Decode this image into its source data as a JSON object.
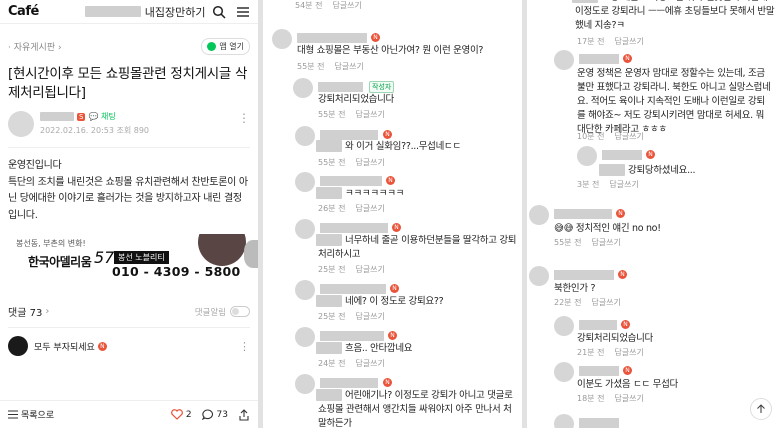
{
  "panel1": {
    "logo": "Café",
    "cafe_name": "내집장만하기",
    "board_link": "· 자유게시판 ›",
    "app_open": "앱 열기",
    "title": "[현시간이후 모든 쇼핑몰관련 정치게시글 삭제처리됩니다]",
    "author_level_badge": "S",
    "author_chat": "채팅",
    "meta": "2022.02.16. 20:53 조회 890",
    "body": [
      "운영진입니다",
      "특단의 조치를 내린것은 쇼핑몰 유치관련해서 찬반토론이 아닌 당에대한 이야기로 흘러가는 것을 방지하고자 내린 결정입니다."
    ],
    "ad": {
      "small": "봉선동, 부촌의 변화!",
      "brand": "한국아델리움",
      "num": "57",
      "tag": "봉선 노블리티",
      "phone": "010 - 4309 - 5800"
    },
    "comments_label": "댓글 73",
    "alarm_label": "댓글알림",
    "first_comment": "모두 부자되세요",
    "bottom": {
      "list": "목록으로",
      "likes": "2",
      "comments": "73"
    }
  },
  "panel2": {
    "comments": [
      {
        "time": "54분 전",
        "reply": "답글쓰기"
      },
      {
        "text": "대형 쇼핑몰은 부동산 아닌가여? 뭔 이런 운영이?",
        "time": "55분 전",
        "reply": "답글쓰기"
      },
      {
        "manager": "작성자",
        "text": "강퇴처리되었습니다",
        "time": "55분 전",
        "reply": "답글쓰기"
      },
      {
        "text": "와 이거 실화임??...무섭네ㄷㄷ",
        "time": "55분 전",
        "reply": "답글쓰기"
      },
      {
        "text": "ㅋㅋㅋㅋㅋㅋㅋ",
        "time": "26분 전",
        "reply": "답글쓰기"
      },
      {
        "text": "너무하네 줄곧 이용하던분들을 딸각하고 강퇴처리하시고",
        "time": "25분 전",
        "reply": "답글쓰기"
      },
      {
        "text": "네에? 이 정도로 강퇴요??",
        "time": "25분 전",
        "reply": "답글쓰기"
      },
      {
        "text": "흐음.. 안타깝네요",
        "time": "24분 전",
        "reply": "답글쓰기"
      },
      {
        "text": "어린애기나? 이정도로 강퇴가 아니고 댓글로 쇼핑몰 관련해서 앵간치들 싸워야지 아주 만나서 처말하든가"
      }
    ]
  },
  "panel3": {
    "comments": [
      {
        "text_partial": "초등 애들도 이정도선 뭐가 걸못된지 아는데 이정도로 강퇴라니 ㅡㅡ에휴 초딩들보다 못해서 반말했네 지송?ㅋ",
        "time": "17분 전",
        "reply": "답글쓰기"
      },
      {
        "text": "운영 정책은 운영자 맘대로 정할수는 있는데, 조금 불만 표했다고 강퇴라니. 북한도 아니고 실망스럽네요. 적어도 육이나 지속적인 도배나 이런일로 강퇴를 해야죠~ 저도 강퇴시키려면 맘대로 허세요. 뭐 대단한 카페라고 ㅎㅎㅎ",
        "time": "10분 전",
        "reply": "답글쓰기"
      },
      {
        "text": "강퇴당하셨네요...",
        "time": "3분 전",
        "reply": "답글쓰기"
      },
      {
        "text": "😅😅 정치적인 얘긴 no no!",
        "time": "55분 전",
        "reply": "답글쓰기"
      },
      {
        "text": "북한인가 ?",
        "time": "22분 전",
        "reply": "답글쓰기"
      },
      {
        "text": "강퇴처리되었습니다",
        "time": "21분 전",
        "reply": "답글쓰기"
      },
      {
        "text": "이분도 가셨음 ㄷㄷ 무섭다",
        "time": "18분 전",
        "reply": "답글쓰기"
      }
    ]
  }
}
